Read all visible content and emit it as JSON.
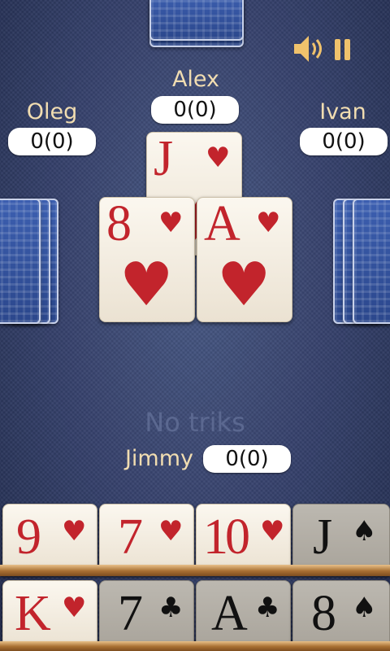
{
  "players": {
    "top": {
      "name": "Alex",
      "score": "0(0)"
    },
    "left": {
      "name": "Oleg",
      "score": "0(0)"
    },
    "right": {
      "name": "Ivan",
      "score": "0(0)"
    },
    "bottom": {
      "name": "Jimmy",
      "score": "0(0)"
    }
  },
  "status_text": "No triks",
  "table_cards": [
    {
      "rank": "J",
      "suit": "♥"
    },
    {
      "rank": "8",
      "suit": "♥"
    },
    {
      "rank": "A",
      "suit": "♥"
    }
  ],
  "hand_row1": [
    {
      "rank": "9",
      "suit": "♥"
    },
    {
      "rank": "7",
      "suit": "♥"
    },
    {
      "rank": "10",
      "suit": "♥"
    },
    {
      "rank": "J",
      "suit": "♠"
    }
  ],
  "hand_row2": [
    {
      "rank": "K",
      "suit": "♥"
    },
    {
      "rank": "7",
      "suit": "♣"
    },
    {
      "rank": "A",
      "suit": "♣"
    },
    {
      "rank": "8",
      "suit": "♠"
    }
  ],
  "icons": {
    "sound": "speaker-icon",
    "pause": "pause-icon"
  },
  "colors": {
    "name_text": "#f1ddb1",
    "red_suit": "#c2242c",
    "black_suit": "#111111",
    "status_text": "#5b6890"
  }
}
